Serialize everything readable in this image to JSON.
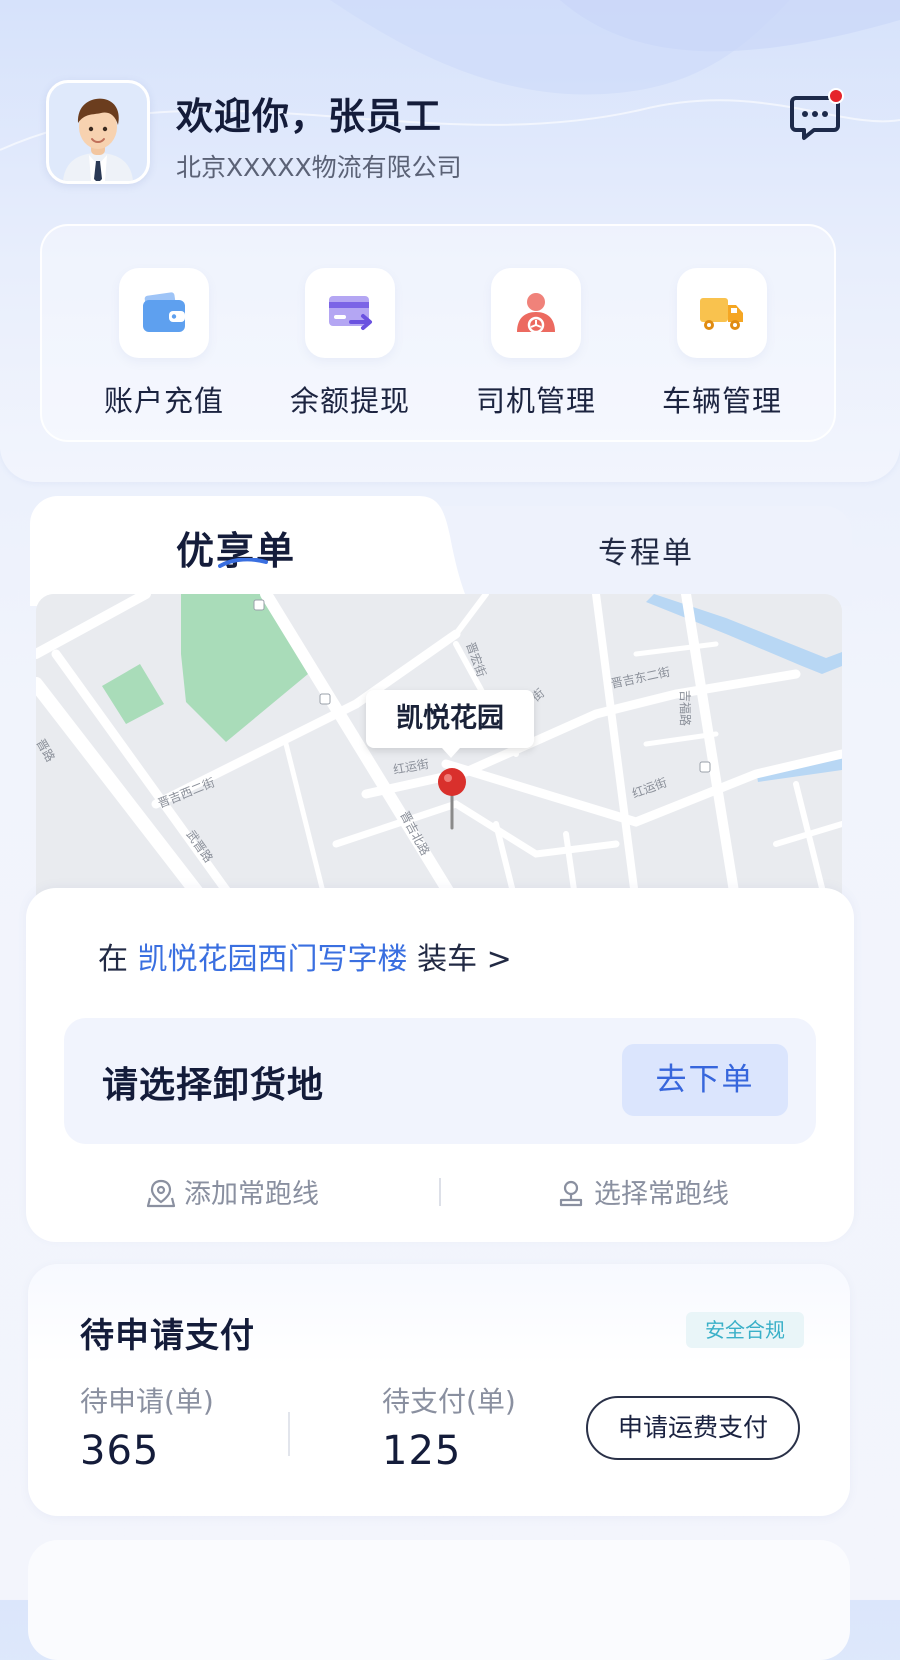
{
  "header": {
    "greeting": "欢迎你，张员工",
    "company": "北京XXXXX物流有限公司",
    "avatar_icon": "user-avatar-icon",
    "message_icon": "message-bubble-icon",
    "has_unread": true
  },
  "quick_actions": [
    {
      "label": "账户充值",
      "icon": "wallet-icon"
    },
    {
      "label": "余额提现",
      "icon": "card-withdraw-icon"
    },
    {
      "label": "司机管理",
      "icon": "driver-icon"
    },
    {
      "label": "车辆管理",
      "icon": "truck-icon"
    }
  ],
  "order_tabs": [
    {
      "label": "优享单",
      "active": true
    },
    {
      "label": "专程单",
      "active": false
    }
  ],
  "map": {
    "marker_label": "凯悦花园"
  },
  "order": {
    "load_prefix": "在",
    "load_place": "凯悦花园西门写字楼",
    "load_suffix": "装车",
    "load_arrow": ">",
    "unload_placeholder": "请选择卸货地",
    "order_button": "去下单",
    "add_route": "添加常跑线",
    "select_route": "选择常跑线"
  },
  "payment": {
    "title": "待申请支付",
    "badge": "安全合规",
    "pending_apply_label": "待申请(单)",
    "pending_apply_value": "365",
    "pending_pay_label": "待支付(单)",
    "pending_pay_value": "125",
    "apply_button": "申请运费支付"
  },
  "colors": {
    "accent": "#3a6fe0",
    "badge_text": "#3ab0c8",
    "unread_dot": "#e5242b"
  }
}
